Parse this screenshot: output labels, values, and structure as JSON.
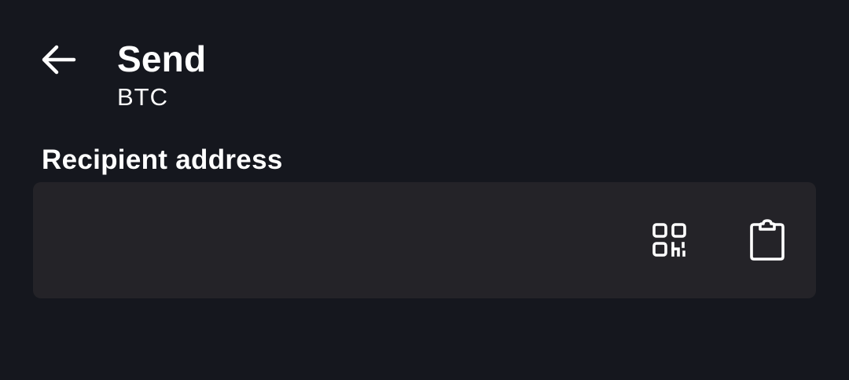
{
  "header": {
    "back_icon": "arrow-left-icon",
    "title": "Send",
    "subtitle": "BTC"
  },
  "recipient": {
    "label": "Recipient address",
    "value": "",
    "placeholder": "",
    "qr_icon": "qr-code-scan-icon",
    "paste_icon": "clipboard-paste-icon"
  },
  "colors": {
    "background": "#15171e",
    "field_background": "#242328",
    "text": "#ffffff"
  }
}
